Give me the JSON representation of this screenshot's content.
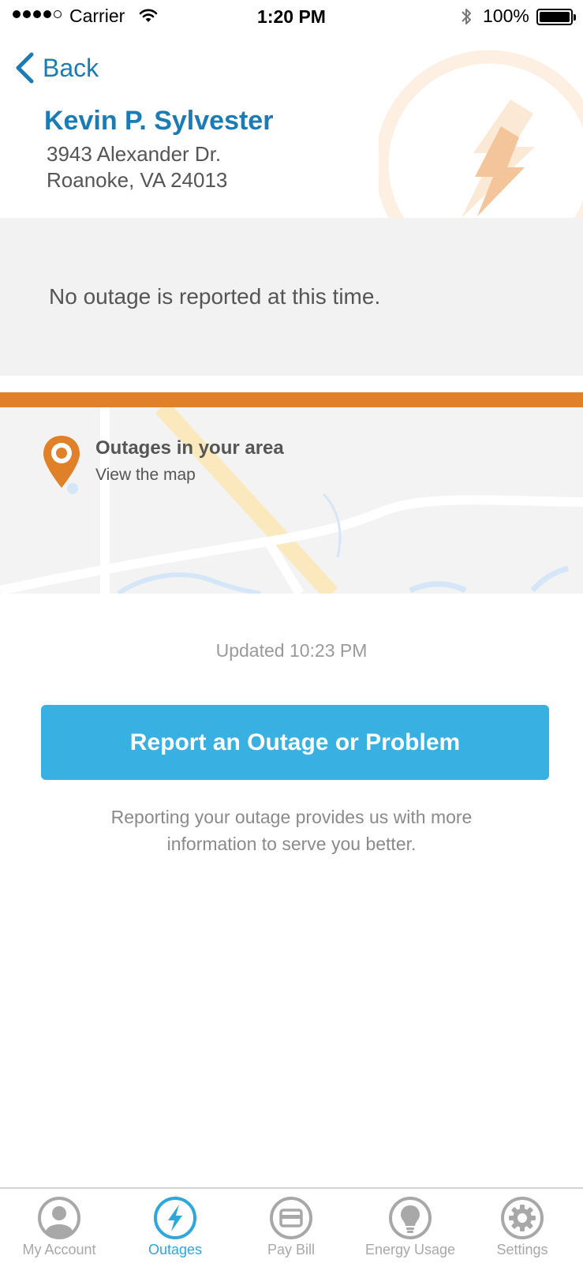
{
  "status_bar": {
    "carrier": "Carrier",
    "time": "1:20 PM",
    "battery": "100%",
    "wifi_icon": "wifi-icon",
    "bluetooth_icon": "bluetooth-icon"
  },
  "header": {
    "back_label": "Back",
    "account_name": "Kevin P. Sylvester",
    "address_line1": "3943 Alexander Dr.",
    "address_line2": "Roanoke, VA 24013"
  },
  "outage_status": {
    "message": "No outage is reported at this time."
  },
  "map_card": {
    "title": "Outages in your area",
    "link": "View the map"
  },
  "updated": "Updated 10:23 PM",
  "report": {
    "button_label": "Report an Outage or Problem",
    "helper_line1": "Reporting your outage provides us with more",
    "helper_line2": "information to serve you better."
  },
  "tab_bar": {
    "items": [
      {
        "label": "My Account",
        "icon": "account-icon"
      },
      {
        "label": "Outages",
        "icon": "bolt-icon",
        "active": true
      },
      {
        "label": "Pay Bill",
        "icon": "card-icon"
      },
      {
        "label": "Energy Usage",
        "icon": "bulb-icon"
      },
      {
        "label": "Settings",
        "icon": "gear-icon"
      }
    ]
  },
  "colors": {
    "brand_blue": "#1a7bb5",
    "button_blue": "#38b1e2",
    "accent_orange": "#e0812a",
    "tab_active": "#2da7dc",
    "tab_inactive": "#a8a8a8"
  }
}
